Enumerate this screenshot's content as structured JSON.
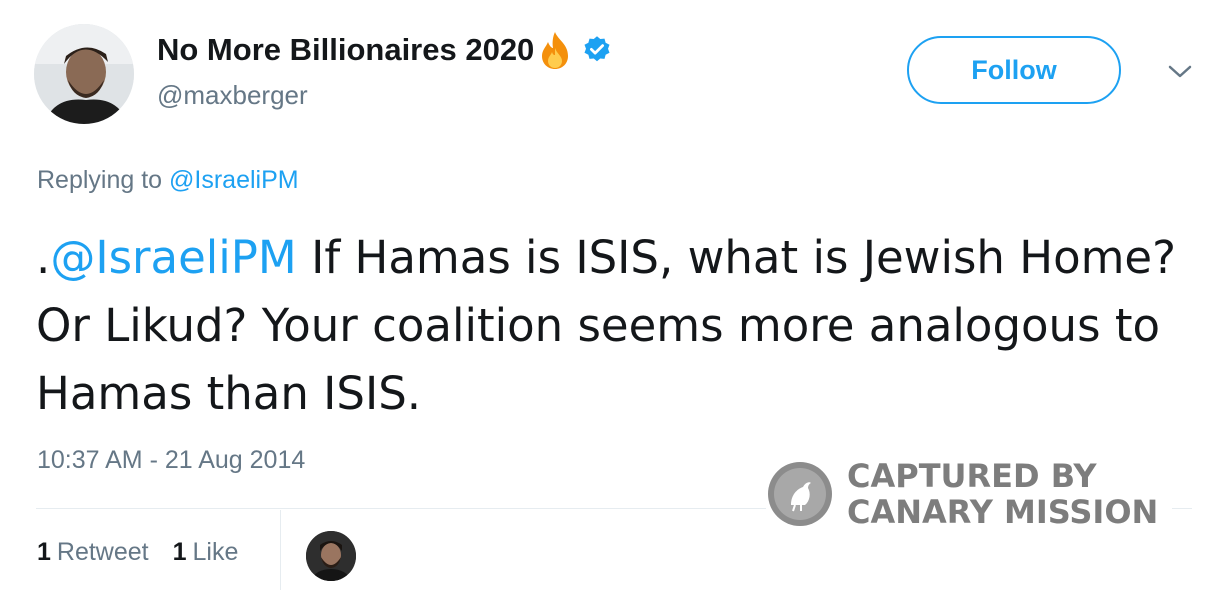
{
  "user": {
    "display_name": "No More Billionaires 2020",
    "handle": "@maxberger",
    "name_emoji_icon": "fire-icon",
    "verified_icon": "verified-badge-icon"
  },
  "follow_button": {
    "label": "Follow"
  },
  "reply_context": {
    "prefix": "Replying to",
    "mention": "@IsraeliPM"
  },
  "tweet": {
    "lead": ".",
    "mention": "@IsraeliPM",
    "body": " If Hamas is ISIS, what is Jewish Home? Or Likud? Your coalition seems more analogous to Hamas than ISIS."
  },
  "timestamp": "10:37 AM - 21 Aug 2014",
  "stats": {
    "retweet_count": "1",
    "retweet_label": "Retweet",
    "like_count": "1",
    "like_label": "Like"
  },
  "watermark": {
    "line1": "CAPTURED BY",
    "line2": "CANARY MISSION"
  },
  "colors": {
    "accent": "#1da1f2",
    "secondary_text": "#657786",
    "primary_text": "#14171a",
    "watermark": "#7d7d7d"
  }
}
